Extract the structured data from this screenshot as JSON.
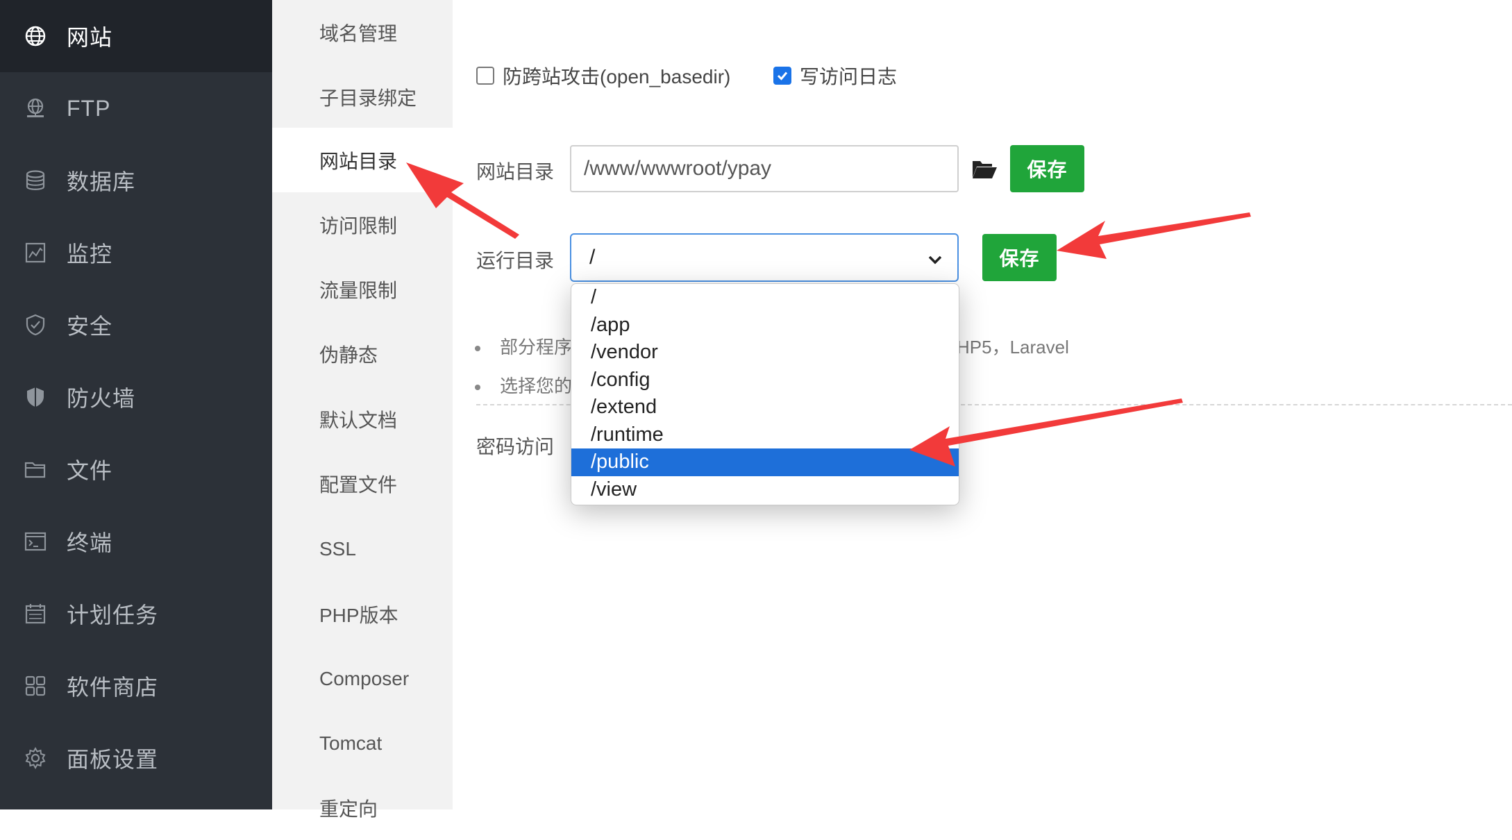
{
  "sidebar": {
    "items": [
      {
        "label": "网站",
        "icon": "globe-icon"
      },
      {
        "label": "FTP",
        "icon": "ftp-globe-icon"
      },
      {
        "label": "数据库",
        "icon": "database-icon"
      },
      {
        "label": "监控",
        "icon": "monitor-chart-icon"
      },
      {
        "label": "安全",
        "icon": "shield-check-icon"
      },
      {
        "label": "防火墙",
        "icon": "firewall-shield-icon"
      },
      {
        "label": "文件",
        "icon": "folder-icon"
      },
      {
        "label": "终端",
        "icon": "terminal-icon"
      },
      {
        "label": "计划任务",
        "icon": "calendar-icon"
      },
      {
        "label": "软件商店",
        "icon": "apps-grid-icon"
      },
      {
        "label": "面板设置",
        "icon": "gear-icon"
      }
    ],
    "active_index": 0
  },
  "submenu": {
    "items": [
      "域名管理",
      "子目录绑定",
      "网站目录",
      "访问限制",
      "流量限制",
      "伪静态",
      "默认文档",
      "配置文件",
      "SSL",
      "PHP版本",
      "Composer",
      "Tomcat",
      "重定向"
    ],
    "active_index": 2
  },
  "options": {
    "basedir_label": "防跨站攻击(open_basedir)",
    "basedir_checked": false,
    "log_label": "写访问日志",
    "log_checked": true
  },
  "site_dir": {
    "label": "网站目录",
    "value": "/www/wwwroot/ypay",
    "save_label": "保存"
  },
  "run_dir": {
    "label": "运行目录",
    "value": "/",
    "save_label": "保存",
    "options": [
      "/",
      "/app",
      "/vendor",
      "/config",
      "/extend",
      "/runtime",
      "/public",
      "/view"
    ],
    "highlighted": "/public"
  },
  "notes": {
    "line1_visible": "部分程序",
    "line1_tail": "HP5，Laravel",
    "line2_visible": "选择您的"
  },
  "password_access": {
    "label": "密码访问"
  },
  "colors": {
    "sidebar_bg": "#2c3138",
    "accent_green": "#20a53a",
    "select_blue": "#1e6fd9",
    "arrow_red": "#f23a3a"
  }
}
